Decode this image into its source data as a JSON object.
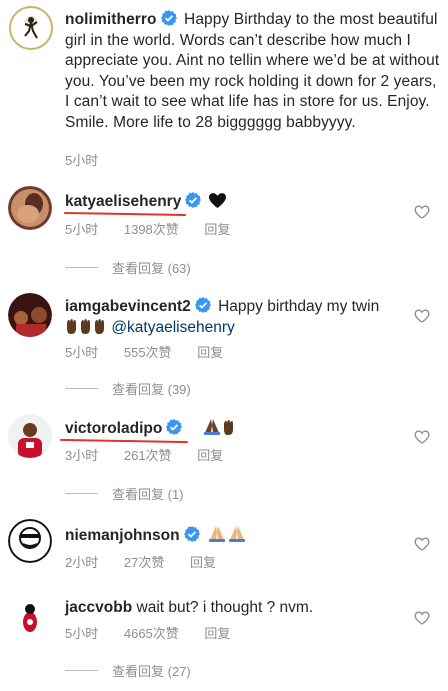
{
  "caption": {
    "username": "nolimitherro",
    "text": "Happy Birthday to the most beautiful girl in the world. Words can’t describe how much I appreciate you. Aint no tellin where we’d be at without you. You’ve been my rock holding it down for 2 years, I can’t wait to see what life has in store for us. Enjoy. Smile. More life to 28 bigggggg babbyyyy.",
    "time": "5小时"
  },
  "comments": [
    {
      "username": "katyaelisehenry",
      "text": "",
      "emoji": "black-heart",
      "time": "5小时",
      "likes": "1398次赞",
      "reply": "回复",
      "view_more": "查看回复 (63)"
    },
    {
      "username": "iamgabevincent2",
      "text": "Happy birthday my twin",
      "mention": "@katyaelisehenry",
      "emoji": "raised-hands",
      "time": "5小时",
      "likes": "555次赞",
      "reply": "回复",
      "view_more": "查看回复 (39)"
    },
    {
      "username": "victoroladipo",
      "text": "",
      "emoji": "praying-hands",
      "time": "3小时",
      "likes": "261次赞",
      "reply": "回复",
      "view_more": "查看回复 (1)"
    },
    {
      "username": "niemanjohnson",
      "text": "",
      "emoji": "praying-hands",
      "time": "2小时",
      "likes": "27次赞",
      "reply": "回复"
    },
    {
      "username": "jaccvobb",
      "text": "wait but? i thought ? nvm.",
      "time": "5小时",
      "likes": "4665次赞",
      "reply": "回复",
      "view_more": "查看回复 (27)"
    }
  ],
  "colors": {
    "verified": "#3897f0",
    "muted": "#8e8e8e",
    "underline": "#e0352b"
  }
}
